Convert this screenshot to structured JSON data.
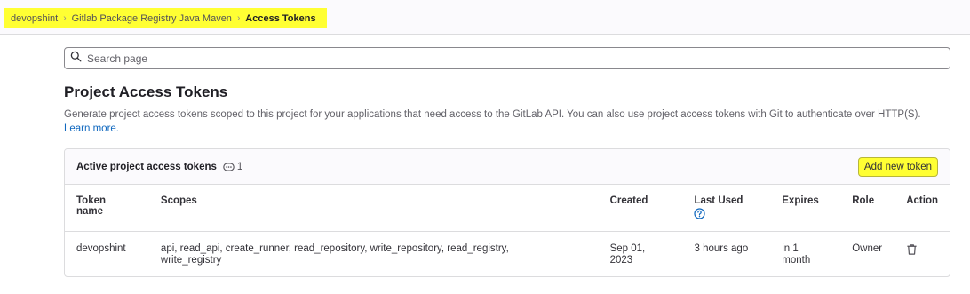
{
  "breadcrumb": {
    "items": [
      "devopshint",
      "Gitlab Package Registry Java Maven",
      "Access Tokens"
    ]
  },
  "search": {
    "placeholder": "Search page"
  },
  "page": {
    "title": "Project Access Tokens",
    "description": "Generate project access tokens scoped to this project for your applications that need access to the GitLab API. You can also use project access tokens with Git to authenticate over HTTP(S).",
    "learn_more": "Learn more."
  },
  "tokens_card": {
    "title": "Active project access tokens",
    "count": "1",
    "add_button": "Add new token",
    "columns": [
      "Token name",
      "Scopes",
      "Created",
      "Last Used",
      "Expires",
      "Role",
      "Action"
    ],
    "rows": [
      {
        "name": "devopshint",
        "scopes": "api, read_api, create_runner, read_repository, write_repository, read_registry, write_registry",
        "created": "Sep 01, 2023",
        "last_used": "3 hours ago",
        "expires": "in 1 month",
        "role": "Owner"
      }
    ]
  },
  "colors": {
    "highlight": "#ffff33",
    "link": "#1068bf",
    "border": "#dcdcde"
  }
}
